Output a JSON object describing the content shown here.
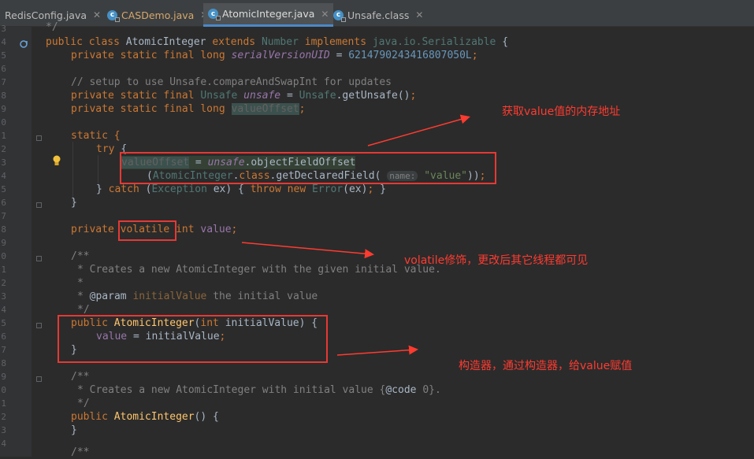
{
  "tabs": [
    {
      "label": "RedisConfig.java"
    },
    {
      "label": "CASDemo.java"
    },
    {
      "label": "AtomicInteger.java"
    },
    {
      "label": "Unsafe.class"
    }
  ],
  "close_glyph": "✕",
  "gutter_numbers": [
    "3",
    "4",
    "5",
    "6",
    "7",
    "8",
    "9",
    "0",
    "1",
    "2",
    "3",
    "4",
    "5",
    "6",
    "7",
    "8",
    "9",
    "0",
    "1",
    "2",
    "3",
    "4",
    "5",
    "6",
    "7",
    "8",
    "9",
    "0",
    "1",
    "2",
    "3",
    "4"
  ],
  "code": {
    "l0": "*/",
    "l1": "public class AtomicInteger extends Number implements java.io.Serializable {",
    "l2": "private static final long serialVersionUID = 6214790243416807050L;",
    "l4": "// setup to use Unsafe.compareAndSwapInt for updates",
    "l5": "private static final Unsafe unsafe = Unsafe.getUnsafe();",
    "l6": "private static final long valueOffset;",
    "l8": "static {",
    "l9": "try {",
    "l10": "valueOffset = unsafe.objectFieldOffset",
    "l11": "(AtomicInteger.class.getDeclaredField( name: \"value\"));",
    "l12": "} catch (Exception ex) { throw new Error(ex); }",
    "l13": "}",
    "l15": "private volatile int value;",
    "l17": "/**",
    "l18": "* Creates a new AtomicInteger with the given initial value.",
    "l19": "*",
    "l20": "* @param initialValue the initial value",
    "l21": "*/",
    "l22": "public AtomicInteger(int initialValue) {",
    "l23": "value = initialValue;",
    "l24": "}",
    "l26": "/**",
    "l27": "* Creates a new AtomicInteger with initial value {@code 0}.",
    "l28": "*/",
    "l29": "public AtomicInteger() {",
    "l30": "}",
    "l32": "/**"
  },
  "annotations": {
    "offset_note": "获取value值的内存地址",
    "volatile_note": "volatile修饰，更改后其它线程都可见",
    "ctor_note": "构造器，通过构造器，给value赋值"
  },
  "colors": {
    "annotation_red": "#ff3b30",
    "editor_bg": "#2b2b2b",
    "keyword": "#cc7832"
  }
}
